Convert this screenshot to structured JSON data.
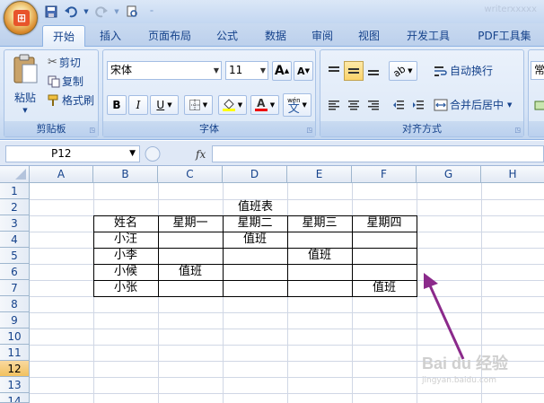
{
  "quick_access": {
    "save_icon": "save-icon",
    "undo_icon": "undo-icon",
    "redo_icon": "redo-icon",
    "preview_icon": "print-preview-icon"
  },
  "window_title": "writerxxxxx",
  "tabs": [
    {
      "label": "开始",
      "active": true
    },
    {
      "label": "插入"
    },
    {
      "label": "页面布局"
    },
    {
      "label": "公式"
    },
    {
      "label": "数据"
    },
    {
      "label": "审阅"
    },
    {
      "label": "视图"
    },
    {
      "label": "开发工具"
    },
    {
      "label": "PDF工具集"
    }
  ],
  "clipboard": {
    "group_label": "剪贴板",
    "paste": "粘贴",
    "cut": "剪切",
    "copy": "复制",
    "format_painter": "格式刷"
  },
  "font": {
    "group_label": "字体",
    "font_name": "宋体",
    "font_size": "11",
    "bold": "B",
    "italic": "I",
    "underline": "U",
    "grow": "A",
    "shrink": "A",
    "font_color": "A",
    "phonetic": "wén",
    "phonetic_char": "文"
  },
  "alignment": {
    "group_label": "对齐方式",
    "wrap_text": "自动换行",
    "merge_center": "合并后居中"
  },
  "number": {
    "format": "常"
  },
  "formula_bar": {
    "name_box": "P12",
    "fx": "fx",
    "content": ""
  },
  "columns": [
    "A",
    "B",
    "C",
    "D",
    "E",
    "F",
    "G",
    "H"
  ],
  "rows": [
    "1",
    "2",
    "3",
    "4",
    "5",
    "6",
    "7",
    "8",
    "9",
    "10",
    "11",
    "12",
    "13",
    "14"
  ],
  "selected_row": "12",
  "sheet": {
    "title": "值班表",
    "header": [
      "姓名",
      "星期一",
      "星期二",
      "星期三",
      "星期四"
    ],
    "data": [
      [
        "小汪",
        "",
        "值班",
        "",
        ""
      ],
      [
        "小李",
        "",
        "",
        "值班",
        ""
      ],
      [
        "小候",
        "值班",
        "",
        "",
        ""
      ],
      [
        "小张",
        "",
        "",
        "",
        "值班"
      ]
    ]
  },
  "watermark_text": "Bai du 经验",
  "watermark_sub": "jingyan.baidu.com",
  "colors": {
    "arrow": "#8b2a8b",
    "selected_row": "#f1c15f"
  }
}
